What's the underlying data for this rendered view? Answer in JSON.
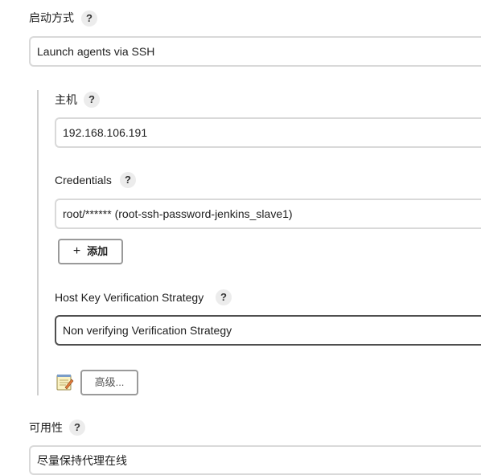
{
  "launch_method": {
    "label": "启动方式",
    "help": "?",
    "value": "Launch agents via SSH"
  },
  "host": {
    "label": "主机",
    "help": "?",
    "value": "192.168.106.191"
  },
  "credentials": {
    "label": "Credentials",
    "help": "?",
    "value": "root/****** (root-ssh-password-jenkins_slave1)",
    "add_icon": "+",
    "add_label": "添加"
  },
  "host_key": {
    "label": "Host Key Verification Strategy",
    "help": "?",
    "value": "Non verifying Verification Strategy"
  },
  "advanced": {
    "icon": "notepad-icon",
    "label": "高级..."
  },
  "availability": {
    "label": "可用性",
    "help": "?",
    "value": "尽量保持代理在线"
  }
}
